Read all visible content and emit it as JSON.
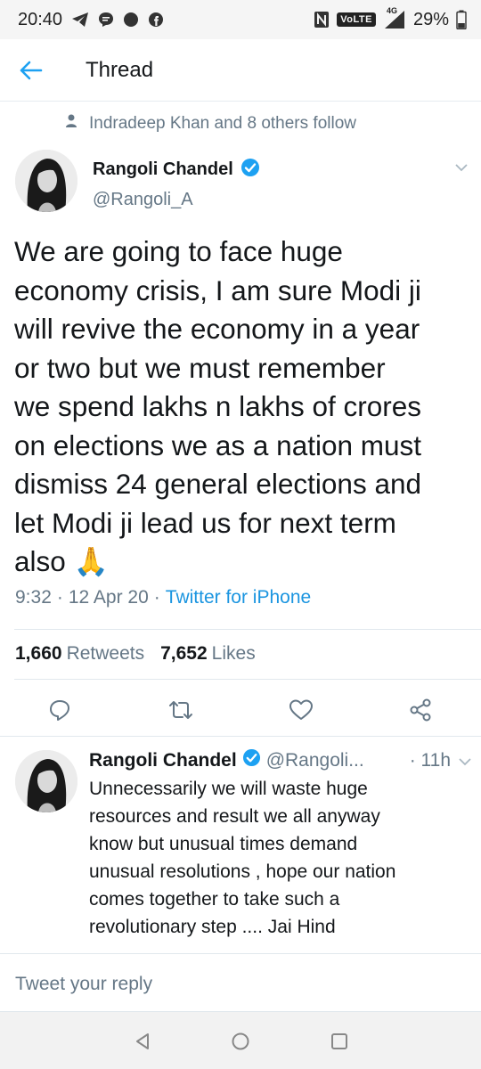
{
  "status_bar": {
    "time": "20:40",
    "network": "VoLTE",
    "network_type": "4G",
    "battery": "29%"
  },
  "header": {
    "title": "Thread"
  },
  "social_context": "Indradeep Khan and 8 others follow",
  "tweet": {
    "author_name": "Rangoli Chandel",
    "author_handle": "@Rangoli_A",
    "text": "We are going to face huge\neconomy crisis, I am sure Modi ji\nwill revive the economy in a year\nor two but we must remember\nwe spend lakhs n lakhs of crores\non elections we as a nation must\ndismiss 24 general elections and\nlet Modi ji lead us for next term\nalso 🙏",
    "time": "9:32",
    "date": "12 Apr 20",
    "source": "Twitter for iPhone",
    "retweets_count": "1,660",
    "retweets_label": "Retweets",
    "likes_count": "7,652",
    "likes_label": "Likes"
  },
  "reply": {
    "author_name": "Rangoli Chandel",
    "author_handle": "@Rangoli...",
    "time": "· 11h",
    "text": "Unnecessarily we will waste huge\nresources and result we all anyway\nknow but unusual times demand\nunusual resolutions , hope our nation\ncomes together to take such a\nrevolutionary step .... Jai Hind"
  },
  "composer": {
    "placeholder": "Tweet your reply"
  },
  "colors": {
    "accent": "#1da1f2",
    "text_primary": "#14171a",
    "text_secondary": "#657786",
    "link": "#1b95e0"
  },
  "icons": {
    "back": "back-arrow-icon",
    "verified": "verified-badge-icon",
    "reply": "reply-icon",
    "retweet": "retweet-icon",
    "like": "heart-icon",
    "share": "share-icon"
  }
}
